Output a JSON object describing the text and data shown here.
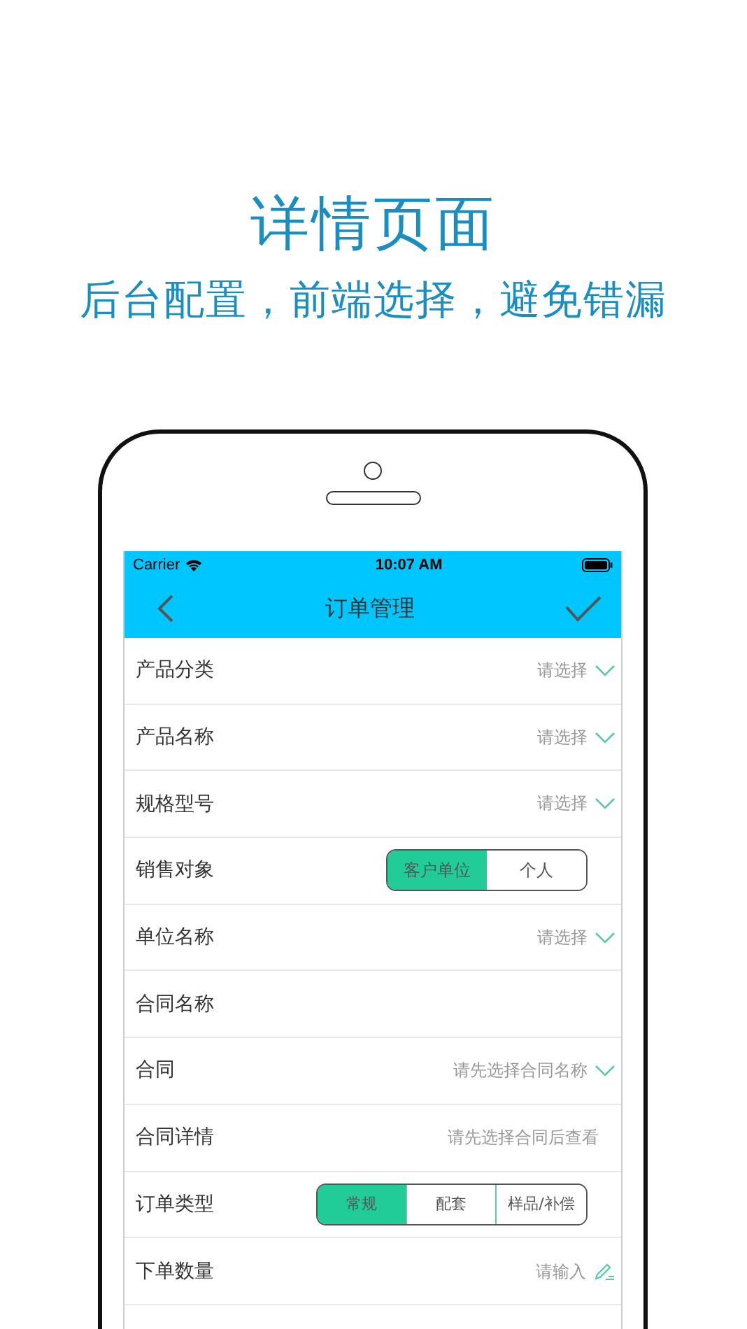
{
  "headline": "详情页面",
  "subheadline": "后台配置，前端选择，避免错漏",
  "status_bar": {
    "carrier": "Carrier",
    "time": "10:07 AM"
  },
  "nav": {
    "title": "订单管理"
  },
  "rows": [
    {
      "kind": "select",
      "label": "产品分类",
      "placeholder": "请选择"
    },
    {
      "kind": "select",
      "label": "产品名称",
      "placeholder": "请选择"
    },
    {
      "kind": "select",
      "label": "规格型号",
      "placeholder": "请选择"
    },
    {
      "kind": "segment",
      "label": "销售对象",
      "options": [
        {
          "label": "客户单位",
          "selected": true
        },
        {
          "label": "个人",
          "selected": false
        }
      ]
    },
    {
      "kind": "select",
      "label": "单位名称",
      "placeholder": "请选择"
    },
    {
      "kind": "text",
      "label": "合同名称"
    },
    {
      "kind": "select",
      "label": "合同",
      "placeholder": "请先选择合同名称"
    },
    {
      "kind": "info",
      "label": "合同详情",
      "placeholder": "请先选择合同后查看"
    },
    {
      "kind": "segment",
      "label": "订单类型",
      "options": [
        {
          "label": "常规",
          "selected": true
        },
        {
          "label": "配套",
          "selected": false
        },
        {
          "label": "样品/补偿",
          "selected": false
        }
      ]
    },
    {
      "kind": "input",
      "label": "下单数量",
      "placeholder": "请输入"
    }
  ]
}
